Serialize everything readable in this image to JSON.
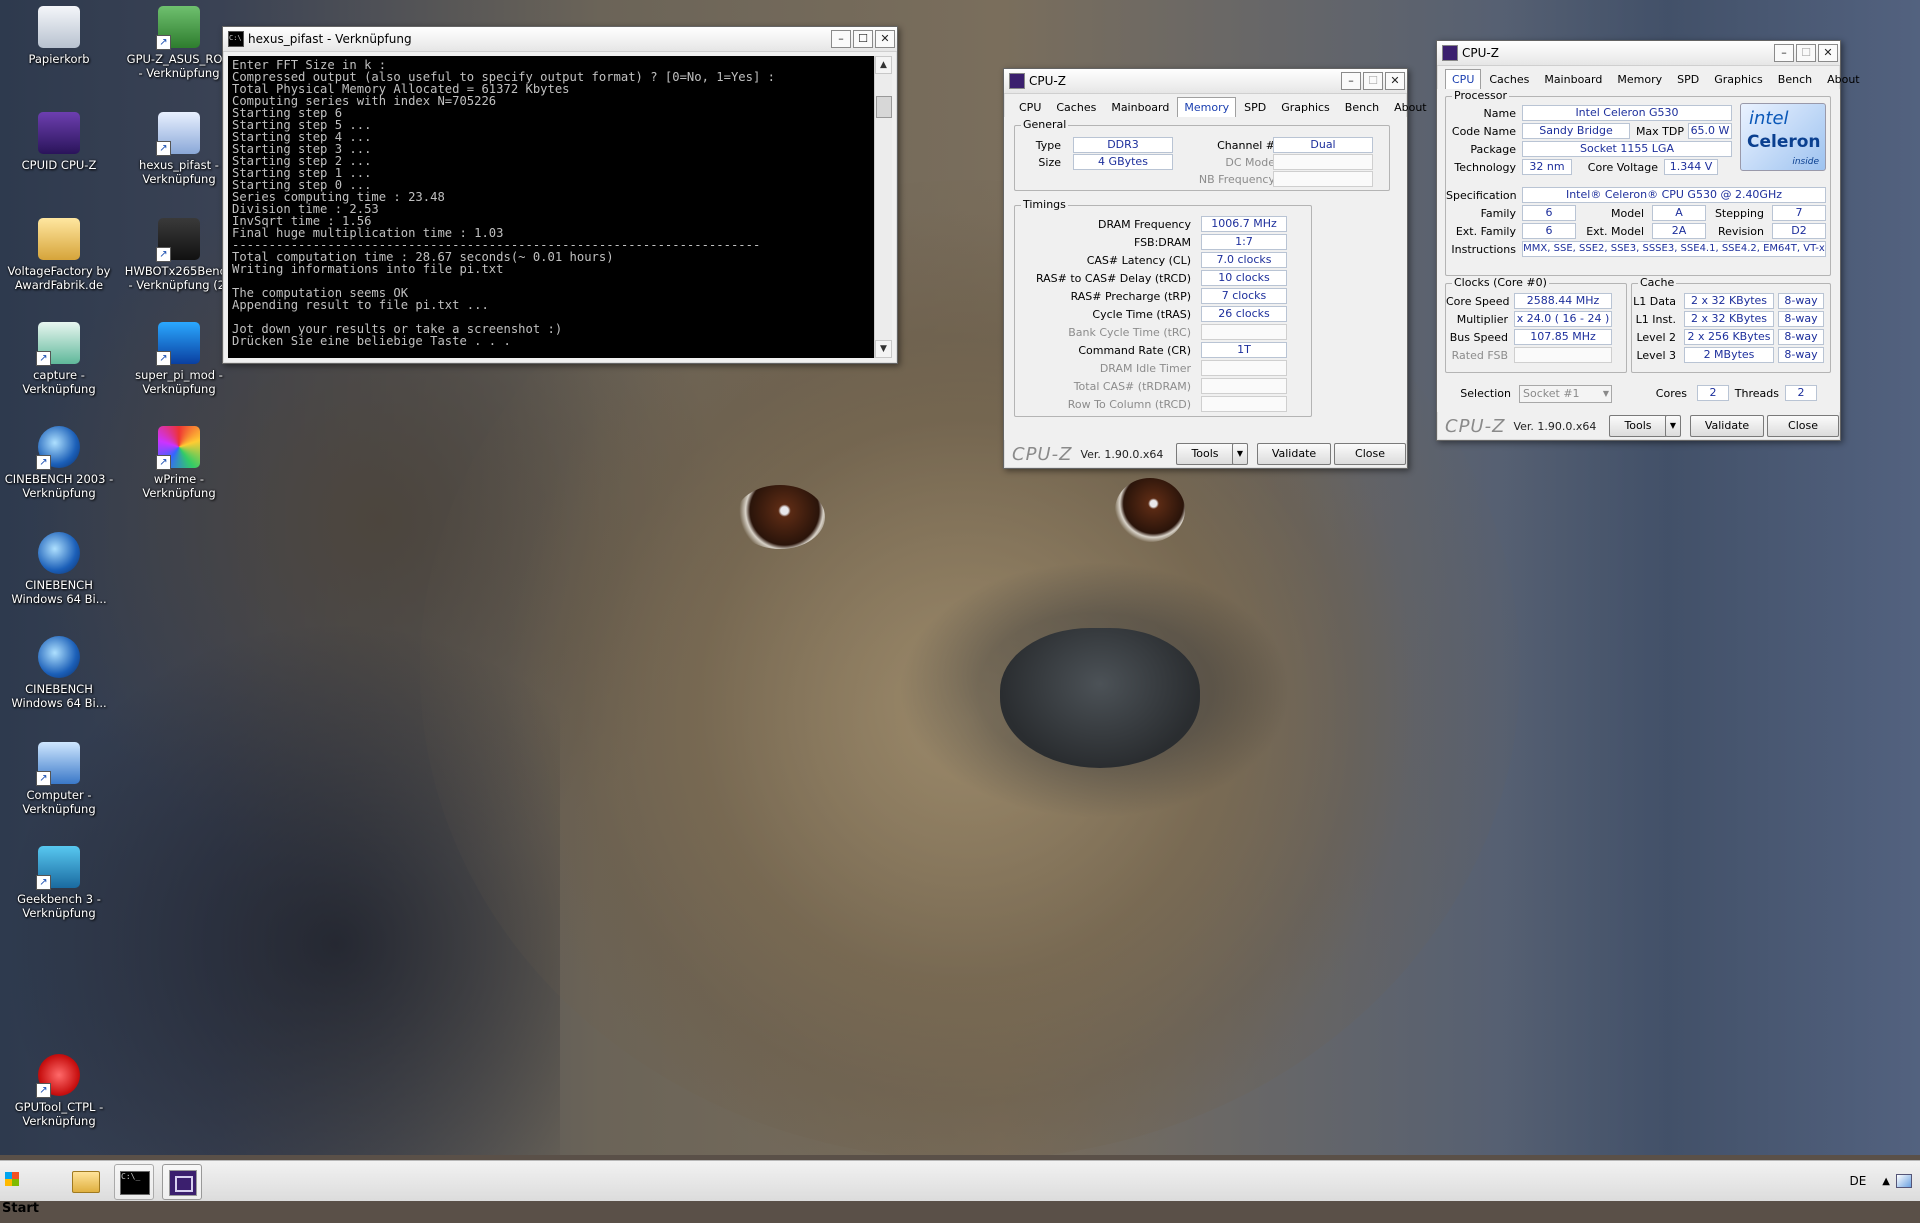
{
  "desktop": {
    "icons": [
      {
        "label": "Papierkorb",
        "icon": "recycle-bin-icon"
      },
      {
        "label": "GPU-Z_ASUS_ROG - Verknüpfung",
        "icon": "gpuz-icon"
      },
      {
        "label": "CPUID CPU-Z",
        "icon": "cpuz-icon"
      },
      {
        "label": "hexus_pifast - Verknüpfung",
        "icon": "hexus-icon"
      },
      {
        "label": "VoltageFactory by AwardFabrik.de",
        "icon": "folder-icon"
      },
      {
        "label": "HWBOTx265Bench - Verknüpfung (2)",
        "icon": "hwbot-icon"
      },
      {
        "label": "capture - Verknüpfung",
        "icon": "capture-icon"
      },
      {
        "label": "super_pi_mod - Verknüpfung",
        "icon": "superpi-icon"
      },
      {
        "label": "CINEBENCH 2003 - Verknüpfung",
        "icon": "cinebench-icon"
      },
      {
        "label": "wPrime - Verknüpfung",
        "icon": "wprime-icon"
      },
      {
        "label": "CINEBENCH Windows 64 Bi...",
        "icon": "cinebench-icon"
      },
      {
        "label": "CINEBENCH Windows 64 Bi...",
        "icon": "cinebench-icon"
      },
      {
        "label": "Computer - Verknüpfung",
        "icon": "computer-icon"
      },
      {
        "label": "Geekbench 3 - Verknüpfung",
        "icon": "geekbench-icon"
      },
      {
        "label": "GPUTool_CTPL - Verknüpfung",
        "icon": "power-icon"
      }
    ]
  },
  "console": {
    "title": "hexus_pifast - Verknüpfung",
    "lines": [
      "Enter FFT Size in k :",
      "Compressed output (also useful to specify output format) ? [0=No, 1=Yes] :",
      "Total Physical Memory Allocated = 61372 Kbytes",
      "Computing series with index N=705226",
      "Starting step 6",
      "Starting step 5 ...",
      "Starting step 4 ...",
      "Starting step 3 ...",
      "Starting step 2 ...",
      "Starting step 1 ...",
      "Starting step 0 ...",
      "Series computing time : 23.48",
      "Division time : 2.53",
      "InvSqrt time : 1.56",
      "Final huge multiplication time : 1.03",
      "------------------------------------------------------------------------",
      "Total computation time : 28.67 seconds(~ 0.01 hours)",
      "Writing informations into file pi.txt",
      "",
      "The computation seems OK",
      "Appending result to file pi.txt ...",
      "",
      "Jot down your results or take a screenshot :)",
      "Drücken Sie eine beliebige Taste . . ."
    ]
  },
  "cpuz_mem": {
    "title": "CPU-Z",
    "tabs": [
      "CPU",
      "Caches",
      "Mainboard",
      "Memory",
      "SPD",
      "Graphics",
      "Bench",
      "About"
    ],
    "active_tab": "Memory",
    "general_title": "General",
    "type_label": "Type",
    "type": "DDR3",
    "size_label": "Size",
    "size": "4 GBytes",
    "channel_label": "Channel #",
    "channel": "Dual",
    "dc_mode_label": "DC Mode",
    "dc_mode": "",
    "nb_freq_label": "NB Frequency",
    "nb_freq": "",
    "timings_title": "Timings",
    "timings": [
      {
        "label": "DRAM Frequency",
        "value": "1006.7 MHz",
        "dim": false
      },
      {
        "label": "FSB:DRAM",
        "value": "1:7",
        "dim": false
      },
      {
        "label": "CAS# Latency (CL)",
        "value": "7.0 clocks",
        "dim": false
      },
      {
        "label": "RAS# to CAS# Delay (tRCD)",
        "value": "10 clocks",
        "dim": false
      },
      {
        "label": "RAS# Precharge (tRP)",
        "value": "7 clocks",
        "dim": false
      },
      {
        "label": "Cycle Time (tRAS)",
        "value": "26 clocks",
        "dim": false
      },
      {
        "label": "Bank Cycle Time (tRC)",
        "value": "",
        "dim": true
      },
      {
        "label": "Command Rate (CR)",
        "value": "1T",
        "dim": false
      },
      {
        "label": "DRAM Idle Timer",
        "value": "",
        "dim": true
      },
      {
        "label": "Total CAS# (tRDRAM)",
        "value": "",
        "dim": true
      },
      {
        "label": "Row To Column (tRCD)",
        "value": "",
        "dim": true
      }
    ],
    "logo": "CPU-Z",
    "version": "Ver. 1.90.0.x64",
    "tools": "Tools",
    "validate": "Validate",
    "close": "Close"
  },
  "cpuz_cpu": {
    "title": "CPU-Z",
    "tabs": [
      "CPU",
      "Caches",
      "Mainboard",
      "Memory",
      "SPD",
      "Graphics",
      "Bench",
      "About"
    ],
    "active_tab": "CPU",
    "processor_title": "Processor",
    "name_label": "Name",
    "name": "Intel Celeron G530",
    "codename_label": "Code Name",
    "codename": "Sandy Bridge",
    "maxtdp_label": "Max TDP",
    "maxtdp": "65.0 W",
    "package_label": "Package",
    "package": "Socket 1155 LGA",
    "technology_label": "Technology",
    "technology": "32 nm",
    "corevoltage_label": "Core Voltage",
    "corevoltage": "1.344 V",
    "spec_label": "Specification",
    "spec": "Intel® Celeron® CPU G530 @ 2.40GHz",
    "family_label": "Family",
    "family": "6",
    "model_label": "Model",
    "model": "A",
    "stepping_label": "Stepping",
    "stepping": "7",
    "extfamily_label": "Ext. Family",
    "extfamily": "6",
    "extmodel_label": "Ext. Model",
    "extmodel": "2A",
    "revision_label": "Revision",
    "revision": "D2",
    "instructions_label": "Instructions",
    "instructions": "MMX, SSE, SSE2, SSE3, SSSE3, SSE4.1, SSE4.2, EM64T, VT-x",
    "intel_logo": "intel",
    "celeron_logo": "Celeron",
    "inside_logo": "inside",
    "clocks_title": "Clocks (Core #0)",
    "corespeed_label": "Core Speed",
    "corespeed": "2588.44 MHz",
    "multiplier_label": "Multiplier",
    "multiplier": "x 24.0 ( 16 - 24 )",
    "busspeed_label": "Bus Speed",
    "busspeed": "107.85 MHz",
    "ratedfsb_label": "Rated FSB",
    "ratedfsb": "",
    "cache_title": "Cache",
    "cache": [
      {
        "label": "L1 Data",
        "value": "2 x 32 KBytes",
        "way": "8-way"
      },
      {
        "label": "L1 Inst.",
        "value": "2 x 32 KBytes",
        "way": "8-way"
      },
      {
        "label": "Level 2",
        "value": "2 x 256 KBytes",
        "way": "8-way"
      },
      {
        "label": "Level 3",
        "value": "2 MBytes",
        "way": "8-way"
      }
    ],
    "selection_label": "Selection",
    "selection": "Socket #1",
    "cores_label": "Cores",
    "cores": "2",
    "threads_label": "Threads",
    "threads": "2",
    "logo": "CPU-Z",
    "version": "Ver. 1.90.0.x64",
    "tools": "Tools",
    "validate": "Validate",
    "close": "Close"
  },
  "taskbar": {
    "start": "Start",
    "items": [
      "explorer-icon",
      "cmd-icon",
      "cpuz-icon"
    ],
    "lang": "DE"
  }
}
